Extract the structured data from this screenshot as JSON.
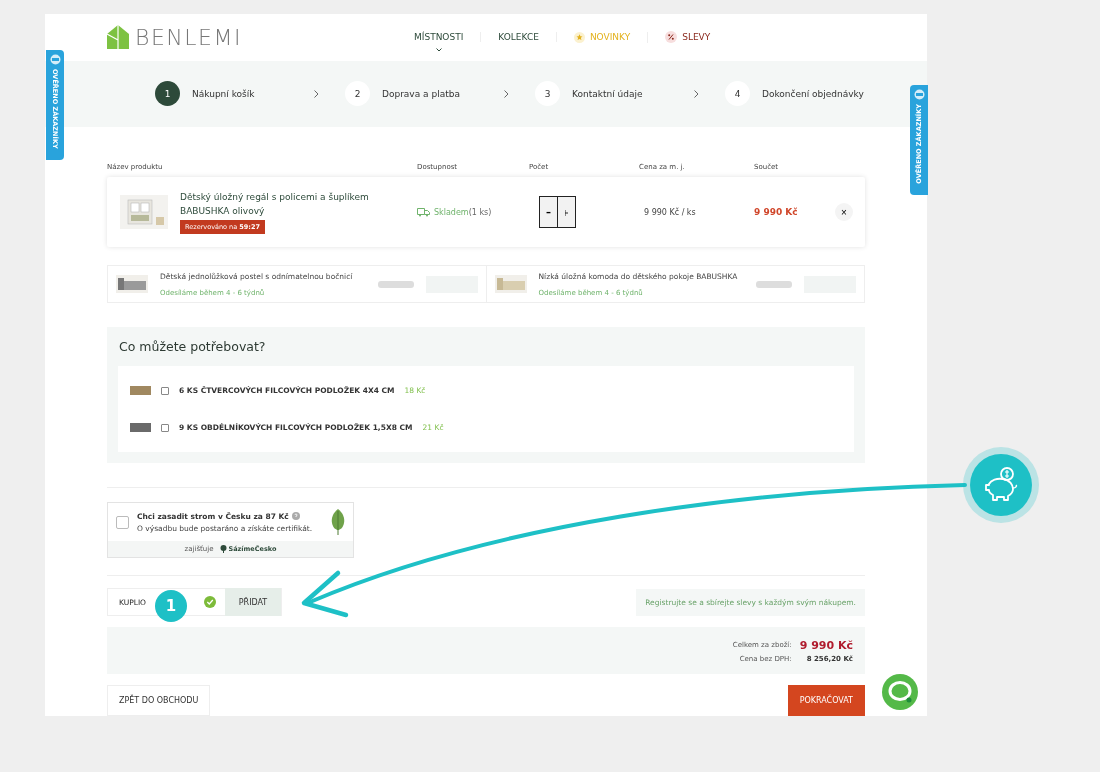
{
  "logo": {
    "text": "BENLEMI"
  },
  "nav": [
    {
      "label": "MÍSTNOSTI",
      "kind": "dropdown"
    },
    {
      "label": "KOLEKCE",
      "kind": "plain"
    },
    {
      "label": "NOVINKY",
      "kind": "star"
    },
    {
      "label": "SLEVY",
      "kind": "percent"
    }
  ],
  "badges": [
    {
      "text": "OVĚŘENO ZÁKAZNÍKY"
    },
    {
      "text": "OVĚŘENO ZÁKAZNÍKY"
    }
  ],
  "steps": [
    {
      "number": "1",
      "label": "Nákupní košík",
      "selected": true
    },
    {
      "number": "2",
      "label": "Doprava a platba",
      "selected": false
    },
    {
      "number": "3",
      "label": "Kontaktní údaje",
      "selected": false
    },
    {
      "number": "4",
      "label": "Dokončení objednávky",
      "selected": false
    }
  ],
  "cart": {
    "columns": [
      "Název produktu",
      "Dostupnost",
      "Počet",
      "Cena za m. j.",
      "Součet"
    ],
    "items": [
      {
        "name": "Dětský úložný regál s policemi a šuplíkem BABUSHKA olivový",
        "reserved_label": "Rezervováno na",
        "reserved_time": "59:27",
        "availability": "Skladem",
        "availability_note": "(1 ks)",
        "minus": "–",
        "unit_price": "9 990 Kč / ks",
        "total": "9 990 Kč",
        "remove": "×"
      }
    ]
  },
  "recommendations": [
    {
      "name": "Dětská jednolůžková postel s odnímatelnou bočnicí",
      "delivery": "Odesíláme během 4 - 6 týdnů"
    },
    {
      "name": "Nízká úložná komoda do dětského pokoje BABUSHKA",
      "delivery": "Odesíláme během 4 - 6 týdnů"
    }
  ],
  "addons": {
    "title": "Co můžete potřebovat?",
    "items": [
      {
        "label": "6 KS ČTVERCOVÝCH FILCOVÝCH PODLOŽEK 4X4 CM",
        "price": "18 Kč",
        "checked": false,
        "color": "#a08860"
      },
      {
        "label": "9 KS OBDÉLNÍKOVÝCH FILCOVÝCH PODLOŽEK 1,5X8 CM",
        "price": "21 Kč",
        "checked": false,
        "color": "#6a6a6a"
      }
    ]
  },
  "tree": {
    "title": "Chci zasadit strom v Česku za 87 Kč",
    "text": "O výsadbu bude postaráno a získáte certifikát.",
    "checked": false,
    "provider_label": "zajišťuje",
    "provider": "SázímeČesko"
  },
  "kuplio": {
    "label": "KUPLIO",
    "number": "1",
    "button": "PŘIDAT",
    "note": "Registrujte se a sbírejte slevy s každým svým nákupem."
  },
  "totals": {
    "goods_label": "Celkem za zboží:",
    "goods": "9 990 Kč",
    "net_label": "Cena bez DPH:",
    "net": "8 256,20 Kč"
  },
  "back_button": "ZPĚT DO OBCHODU",
  "continue_button": "POKRAČOVAT"
}
